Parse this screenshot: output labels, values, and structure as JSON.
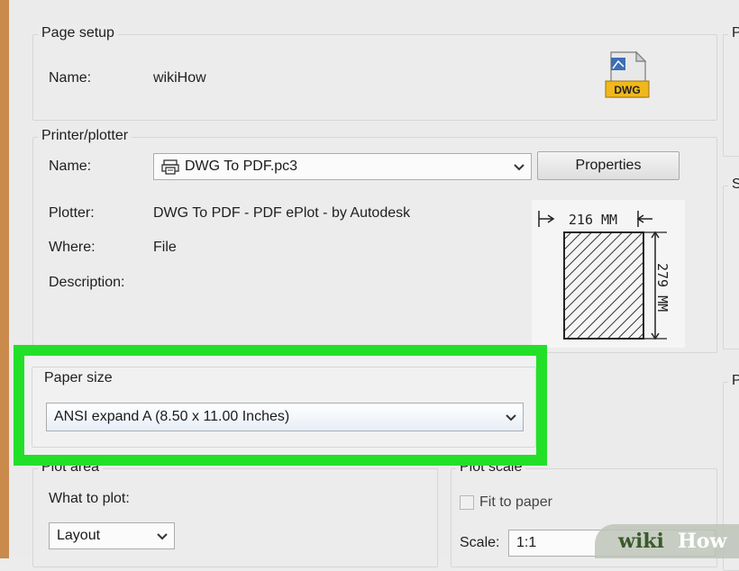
{
  "page_setup": {
    "legend": "Page setup",
    "name_label": "Name:",
    "name_value": "wikiHow",
    "icon": "dwg-file-icon",
    "icon_text": "DWG"
  },
  "printer": {
    "legend": "Printer/plotter",
    "name_label": "Name:",
    "name_value": "DWG To PDF.pc3",
    "printer_icon": "plotter-icon",
    "properties_button": "Properties",
    "plotter_label": "Plotter:",
    "plotter_value": "DWG To PDF - PDF ePlot - by Autodesk",
    "where_label": "Where:",
    "where_value": "File",
    "description_label": "Description:",
    "preview_width": "216 MM",
    "preview_height": "279 MM"
  },
  "paper_size": {
    "legend": "Paper size",
    "value": "ANSI expand A (8.50 x 11.00 Inches)"
  },
  "plot_area": {
    "legend": "Plot area",
    "what_label": "What to plot:",
    "what_value": "Layout"
  },
  "plot_scale": {
    "legend": "Plot scale",
    "fit_label": "Fit to paper",
    "fit_checked": false,
    "scale_label": "Scale:",
    "scale_value": "1:1"
  },
  "right_groups": {
    "letters": [
      "P",
      "S",
      "P"
    ]
  },
  "watermark": {
    "wiki": "wiki",
    "how": "How"
  },
  "colors": {
    "highlight": "#22e028",
    "dialog_bg": "#ebebeb",
    "frame": "#c98a4c"
  }
}
